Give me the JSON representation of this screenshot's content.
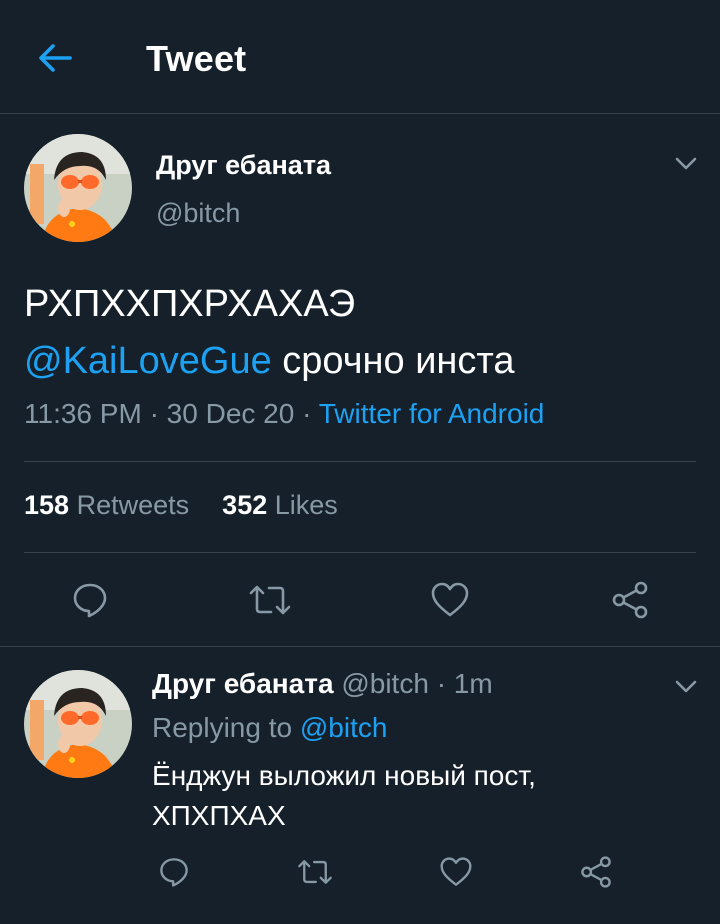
{
  "header": {
    "title": "Tweet",
    "back_icon": "arrow-left-icon",
    "accent": "#1da1f2"
  },
  "tweet": {
    "author_name": "Друг ебаната",
    "author_handle": "@bitch",
    "text_line1": "РХПХХПХРХАХАЭ",
    "mention": "@KaiLoveGue",
    "text_rest": "срочно инста",
    "time": "11:36 PM",
    "date": "30 Dec 20",
    "source": "Twitter for Android",
    "retweets_count": "158",
    "retweets_label": "Retweets",
    "likes_count": "352",
    "likes_label": "Likes",
    "actions": [
      "reply-icon",
      "retweet-icon",
      "like-icon",
      "share-icon"
    ]
  },
  "reply": {
    "author_name": "Друг ебаната",
    "author_handle": "@bitch",
    "time": "1m",
    "replying_prefix": "Replying to",
    "replying_to": "@bitch",
    "text_line1": "Ёнджун выложил новый пост,",
    "text_line2": "ХПХПХАХ",
    "actions": [
      "reply-icon",
      "retweet-icon",
      "like-icon",
      "share-icon"
    ]
  },
  "colors": {
    "background": "#15202b",
    "divider": "#38444d",
    "secondary_text": "#8899a6",
    "link": "#1da1f2"
  }
}
